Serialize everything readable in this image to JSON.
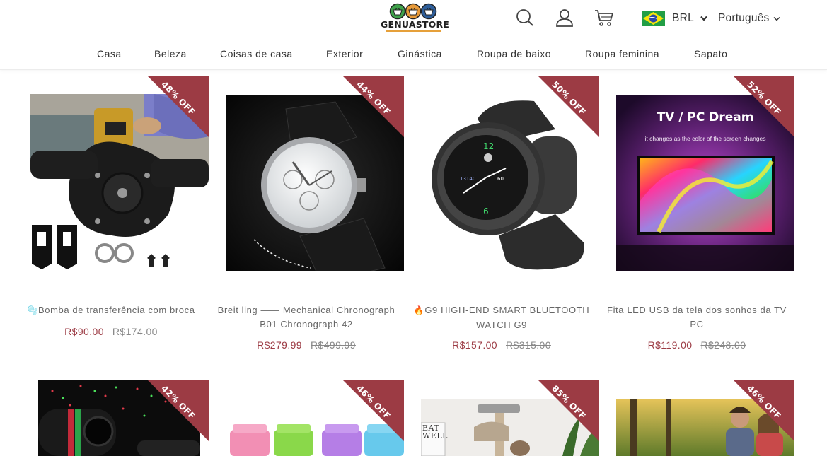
{
  "header": {
    "logo_text": "GENUASTORE",
    "currency": "BRL",
    "language": "Português",
    "colors": {
      "accent": "#9c3b44",
      "logo_underline": "#e6a03a",
      "logo_green": "#3fa14a",
      "logo_orange": "#e79a3a",
      "logo_blue": "#2e5e9a"
    }
  },
  "icons": {
    "search": "search-icon",
    "account": "user-icon",
    "cart": "cart-icon",
    "currency_flag": "brazil-flag-icon"
  },
  "nav": {
    "items": [
      "Casa",
      "Beleza",
      "Coisas de casa",
      "Exterior",
      "Ginástica",
      "Roupa de baixo",
      "Roupa feminina",
      "Sapato"
    ]
  },
  "products": [
    {
      "badge": "48% OFF",
      "prefix": "🫧",
      "title": "Bomba de transferência com broca",
      "price": "R$90.00",
      "old_price": "R$174.00"
    },
    {
      "badge": "44% OFF",
      "prefix": "",
      "title": "Breit ling —— Mechanical Chronograph B01 Chronograph 42",
      "price": "R$279.99",
      "old_price": "R$499.99"
    },
    {
      "badge": "50% OFF",
      "prefix": "🔥",
      "title": "G9 HIGH-END SMART BLUETOOTH WATCH G9",
      "price": "R$157.00",
      "old_price": "R$315.00"
    },
    {
      "badge": "52% OFF",
      "prefix": "",
      "title": "Fita LED USB da tela dos sonhos da TV PC",
      "price": "R$119.00",
      "old_price": "R$248.00",
      "image_text": {
        "headline": "TV / PC  Dream",
        "caption": "it changes as the color of the screen changes"
      }
    },
    {
      "badge": "42% OFF"
    },
    {
      "badge": "46% OFF"
    },
    {
      "badge": "85% OFF",
      "image_text": "EAT WELL"
    },
    {
      "badge": "46% OFF"
    }
  ]
}
